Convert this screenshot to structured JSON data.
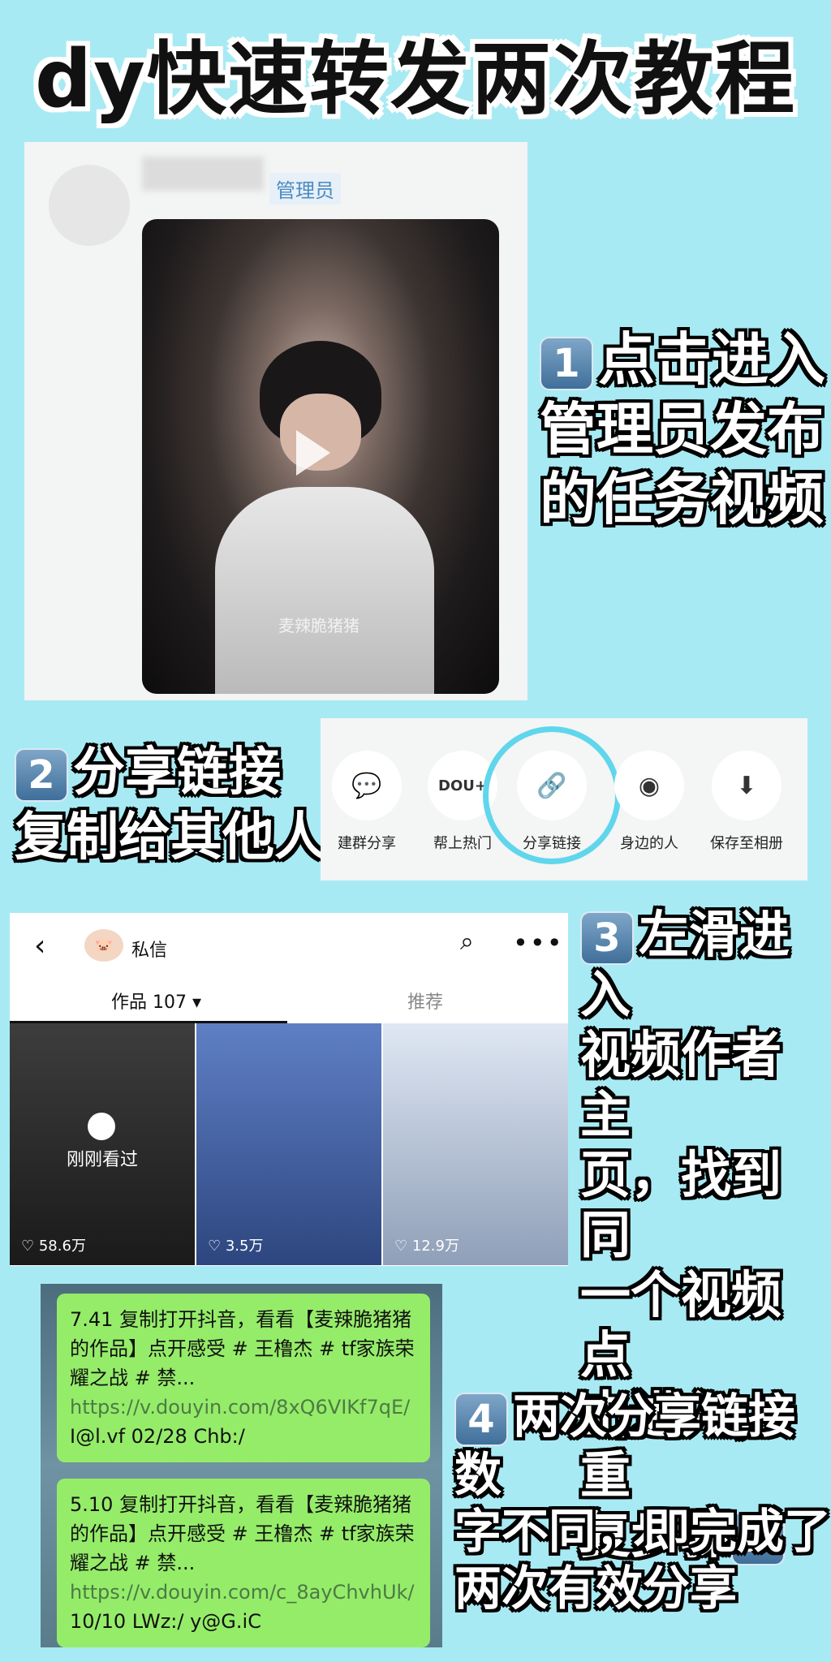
{
  "title": "dy快速转发两次教程",
  "step1": {
    "admin_label": "管理员",
    "number": "1",
    "instruction_lines": [
      "点击进入",
      "管理员发布",
      "的任务视频"
    ],
    "watermark": "麦辣脆猪猪"
  },
  "step2": {
    "number": "2",
    "instruction_lines": [
      "分享链接",
      "复制给其他人"
    ],
    "share_options": [
      "建群分享",
      "帮上热门",
      "分享链接",
      "身边的人",
      "保存至相册"
    ],
    "dou_badge": "DOU+"
  },
  "step3": {
    "back": "‹",
    "dm_label": "私信",
    "works_tab": "作品 107 ▾",
    "recommend_tab": "推荐",
    "recent_label": "刚刚看过",
    "likes": [
      "58.6万",
      "3.5万",
      "12.9万"
    ],
    "number": "3",
    "instruction_lines": [
      "左滑进入",
      "视频作者主",
      "页，找到同",
      "一个视频点",
      "击进入，重",
      "复步骤"
    ],
    "trailing_number": "2"
  },
  "step4": {
    "messages": [
      {
        "text": "7.41 复制打开抖音，看看【麦辣脆猪猪的作品】点开感受 # 王橹杰 # tf家族荣耀之战 # 禁... ",
        "url": "https://v.douyin.com/8xQ6VIKf7qE/",
        "tail": " I@l.vf 02/28 Chb:/"
      },
      {
        "text": "5.10 复制打开抖音，看看【麦辣脆猪猪的作品】点开感受 # 王橹杰 # tf家族荣耀之战 # 禁... ",
        "url": "https://v.douyin.com/c_8ayChvhUk/",
        "tail": " 10/10 LWz:/ y@G.iC"
      }
    ],
    "number": "4",
    "instruction_lines": [
      "两次分享链接数",
      "字不同，即完成了",
      "两次有效分享"
    ]
  }
}
